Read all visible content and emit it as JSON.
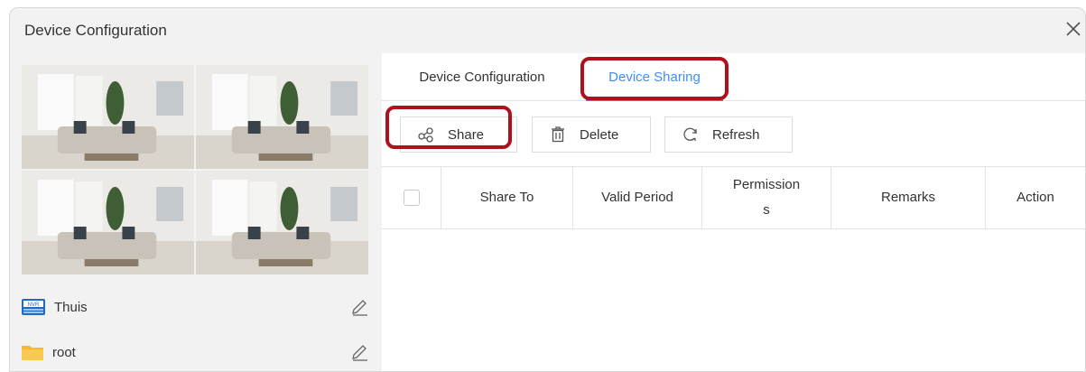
{
  "dialog": {
    "title": "Device Configuration",
    "close_icon": "close-icon"
  },
  "left": {
    "preview_tiles": 4,
    "devices": [
      {
        "label": "Thuis",
        "icon": "nvr-icon",
        "edit_icon": "pencil-icon"
      },
      {
        "label": "root",
        "icon": "folder-icon",
        "edit_icon": "pencil-icon"
      }
    ]
  },
  "tabs": [
    {
      "label": "Device Configuration",
      "active": false
    },
    {
      "label": "Device Sharing",
      "active": true
    }
  ],
  "toolbar": {
    "share_label": "Share",
    "delete_label": "Delete",
    "refresh_label": "Refresh"
  },
  "table": {
    "columns": [
      "Share To",
      "Valid Period",
      "Permission\ns",
      "Remarks",
      "Action"
    ],
    "rows": []
  },
  "colors": {
    "accent": "#3e8ef7",
    "highlight": "#b0101a",
    "panel_bg": "#f2f2f2",
    "border": "#e3e3e3"
  }
}
